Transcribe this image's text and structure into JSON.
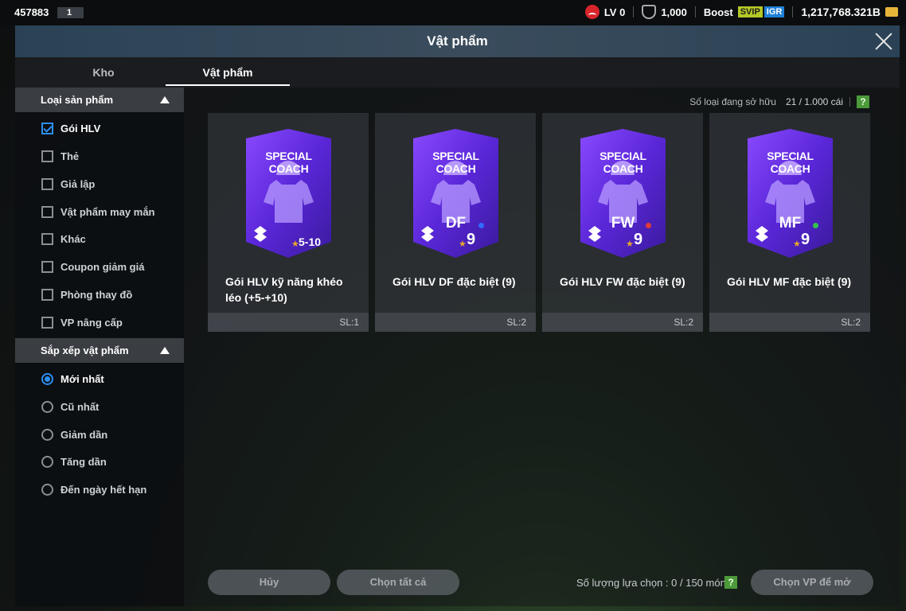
{
  "topbar": {
    "uid": "457883",
    "uid_badge": "1",
    "level": "LV 0",
    "shield_value": "1,000",
    "boost_label": "Boost",
    "svip": "SVIP",
    "igr": "IGR",
    "gold": "1,217,768.321B"
  },
  "window": {
    "title": "Vật phẩm",
    "tabs": [
      {
        "label": "Kho",
        "active": false
      },
      {
        "label": "Vật phẩm",
        "active": true
      }
    ]
  },
  "sidebar": {
    "product_type": {
      "title": "Loại sản phẩm",
      "options": [
        {
          "label": "Gói HLV",
          "checked": true
        },
        {
          "label": "Thẻ",
          "checked": false
        },
        {
          "label": "Giả lập",
          "checked": false
        },
        {
          "label": "Vật phẩm may mắn",
          "checked": false
        },
        {
          "label": "Khác",
          "checked": false
        },
        {
          "label": "Coupon giảm giá",
          "checked": false
        },
        {
          "label": "Phòng thay đồ",
          "checked": false
        },
        {
          "label": "VP nâng cấp",
          "checked": false
        }
      ]
    },
    "sort": {
      "title": "Sắp xếp vật phẩm",
      "options": [
        {
          "label": "Mới nhất",
          "selected": true
        },
        {
          "label": "Cũ nhất",
          "selected": false
        },
        {
          "label": "Giảm dần",
          "selected": false
        },
        {
          "label": "Tăng dần",
          "selected": false
        },
        {
          "label": "Đến ngày hết hạn",
          "selected": false
        }
      ]
    }
  },
  "content": {
    "owned_label": "Số loại đang sở hữu",
    "owned_value": "21 / 1.000 cái",
    "help": "?",
    "items": [
      {
        "pack_title": "SPECIAL COACH",
        "position": "",
        "grade": "5-10",
        "dot_color": "",
        "name": "Gói HLV kỹ năng khéo léo (+5-+10)",
        "qty": "SL:1"
      },
      {
        "pack_title": "SPECIAL COACH",
        "position": "DF",
        "grade": "9",
        "dot_color": "#2f6cff",
        "name": "Gói HLV DF đặc biệt (9)",
        "qty": "SL:2"
      },
      {
        "pack_title": "SPECIAL COACH",
        "position": "FW",
        "grade": "9",
        "dot_color": "#e03a3a",
        "name": "Gói HLV FW đặc biệt (9)",
        "qty": "SL:2"
      },
      {
        "pack_title": "SPECIAL COACH",
        "position": "MF",
        "grade": "9",
        "dot_color": "#35c24a",
        "name": "Gói HLV MF đặc biệt (9)",
        "qty": "SL:2"
      }
    ]
  },
  "footer": {
    "cancel": "Hủy",
    "select_all": "Chọn tất cả",
    "selection_count": "Số lượng lựa chọn : 0 / 150 món",
    "open": "Chọn VP để mở"
  }
}
